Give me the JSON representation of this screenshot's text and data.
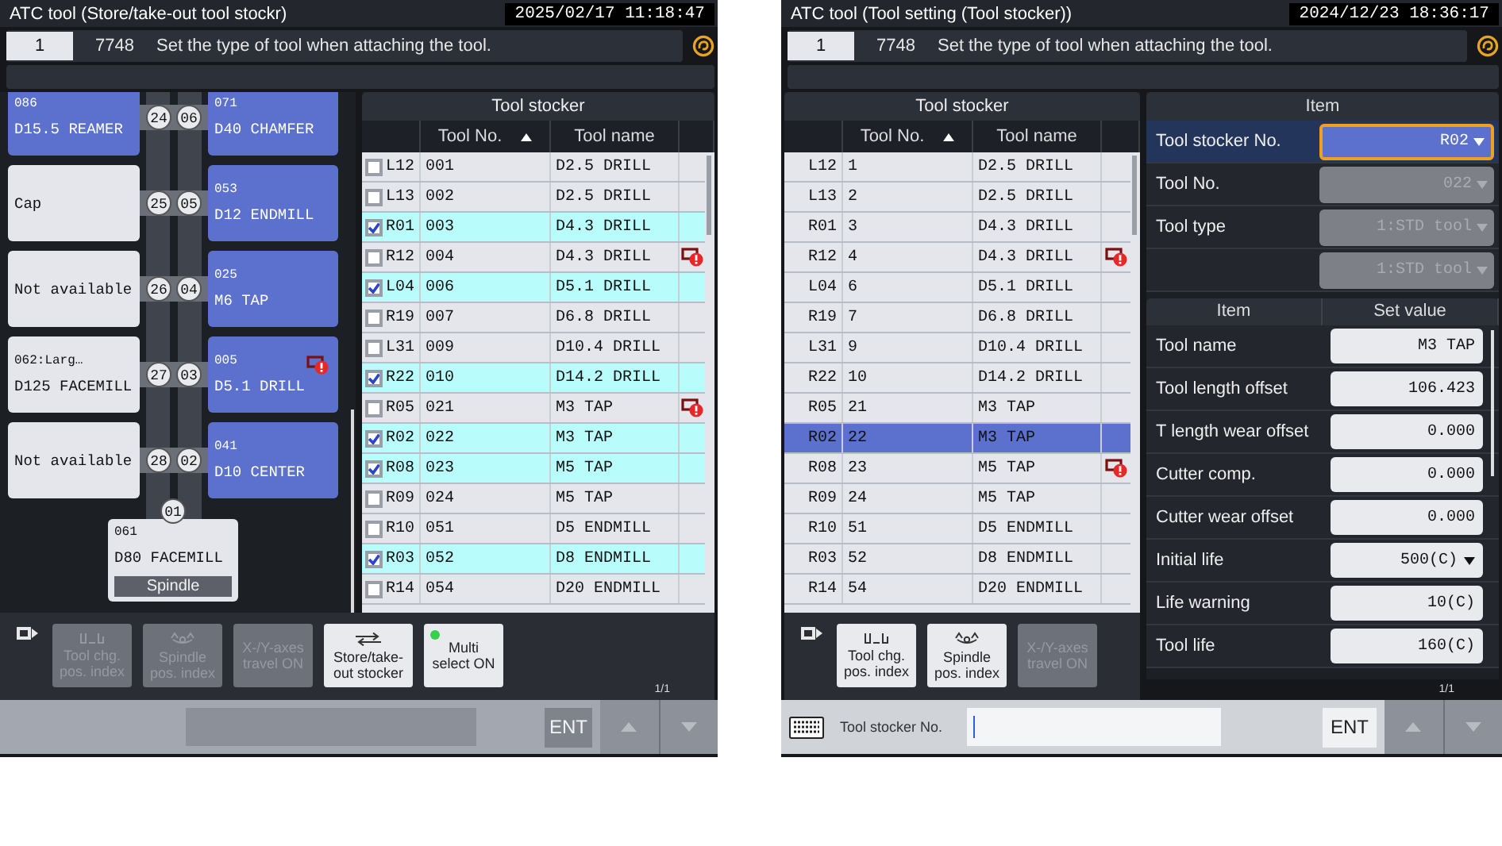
{
  "screens": [
    {
      "title": "ATC tool (Store/take-out tool stockr)",
      "datetime": "2025/02/17 11:18:47",
      "message": {
        "number": "1",
        "code": "7748",
        "text": "Set the type of tool when attaching the tool."
      },
      "magazine": {
        "pockets": [
          {
            "left": {
              "kind": "stored",
              "lines": [
                "086",
                "D15.5 REAMER"
              ],
              "pocket": "24",
              "alert": false
            },
            "right": {
              "kind": "stored",
              "lines": [
                "071",
                "D40 CHAMFER"
              ],
              "pocket": "06",
              "alert": false
            }
          },
          {
            "left": {
              "kind": "blocked",
              "lines": [
                "Cap"
              ],
              "pocket": "25",
              "alert": false
            },
            "right": {
              "kind": "stored",
              "lines": [
                "053",
                "D12 ENDMILL"
              ],
              "pocket": "05",
              "alert": false
            }
          },
          {
            "left": {
              "kind": "blocked",
              "lines": [
                "Not available"
              ],
              "pocket": "26",
              "alert": false
            },
            "right": {
              "kind": "stored",
              "lines": [
                "025",
                "M6 TAP"
              ],
              "pocket": "04",
              "alert": false
            }
          },
          {
            "left": {
              "kind": "blocked",
              "lines": [
                "062:Larg…",
                "D125 FACEMILL"
              ],
              "pocket": "27",
              "alert": false
            },
            "right": {
              "kind": "stored",
              "lines": [
                "005",
                "D5.1 DRILL"
              ],
              "pocket": "03",
              "alert": true
            }
          },
          {
            "left": {
              "kind": "blocked",
              "lines": [
                "Not available"
              ],
              "pocket": "28",
              "alert": false
            },
            "right": {
              "kind": "stored",
              "lines": [
                "041",
                "D10 CENTER"
              ],
              "pocket": "02",
              "alert": false
            }
          }
        ],
        "spindle": {
          "pocket": "01",
          "lines": [
            "061",
            "D80 FACEMILL"
          ],
          "label": "Spindle"
        }
      },
      "stocker": {
        "title": "Tool stocker",
        "columns": [
          "Tool No.",
          "Tool name"
        ],
        "rows": [
          {
            "kind": "checkbox",
            "pocket": "L12",
            "tool_no": "001",
            "name": "D2.5 DRILL",
            "checked": false,
            "alert": false
          },
          {
            "kind": "checkbox",
            "pocket": "L13",
            "tool_no": "002",
            "name": "D2.5 DRILL",
            "checked": false,
            "alert": false
          },
          {
            "kind": "checkbox",
            "pocket": "R01",
            "tool_no": "003",
            "name": "D4.3 DRILL",
            "checked": true,
            "alert": false
          },
          {
            "kind": "checkbox",
            "pocket": "R12",
            "tool_no": "004",
            "name": "D4.3 DRILL",
            "checked": false,
            "alert": true
          },
          {
            "kind": "checkbox",
            "pocket": "L04",
            "tool_no": "006",
            "name": "D5.1 DRILL",
            "checked": true,
            "alert": false
          },
          {
            "kind": "checkbox",
            "pocket": "R19",
            "tool_no": "007",
            "name": "D6.8 DRILL",
            "checked": false,
            "alert": false
          },
          {
            "kind": "checkbox",
            "pocket": "L31",
            "tool_no": "009",
            "name": "D10.4 DRILL",
            "checked": false,
            "alert": false
          },
          {
            "kind": "checkbox",
            "pocket": "R22",
            "tool_no": "010",
            "name": "D14.2 DRILL",
            "checked": true,
            "alert": false
          },
          {
            "kind": "checkbox",
            "pocket": "R05",
            "tool_no": "021",
            "name": "M3 TAP",
            "checked": false,
            "alert": true
          },
          {
            "kind": "checkbox",
            "pocket": "R02",
            "tool_no": "022",
            "name": "M3 TAP",
            "checked": true,
            "alert": false
          },
          {
            "kind": "checkbox",
            "pocket": "R08",
            "tool_no": "023",
            "name": "M5 TAP",
            "checked": true,
            "alert": false
          },
          {
            "kind": "checkbox",
            "pocket": "R09",
            "tool_no": "024",
            "name": "M5 TAP",
            "checked": false,
            "alert": false
          },
          {
            "kind": "checkbox",
            "pocket": "R10",
            "tool_no": "051",
            "name": "D5 ENDMILL",
            "checked": false,
            "alert": false
          },
          {
            "kind": "checkbox",
            "pocket": "R03",
            "tool_no": "052",
            "name": "D8 ENDMILL",
            "checked": true,
            "alert": false
          },
          {
            "kind": "checkbox",
            "pocket": "R14",
            "tool_no": "054",
            "name": "D20 ENDMILL",
            "checked": false,
            "alert": false
          }
        ]
      },
      "function_buttons": [
        {
          "kind": "tool-change",
          "label": "Tool chg. pos. index",
          "disabled": true
        },
        {
          "kind": "spindle",
          "label": "Spindle pos. index",
          "disabled": true
        },
        {
          "kind": "text",
          "label": "X-/Y-axes travel ON",
          "disabled": true
        },
        {
          "kind": "stocker",
          "label": "Store/take-out stocker",
          "disabled": false
        },
        {
          "kind": "indicator",
          "label": "Multi select ON",
          "disabled": false,
          "on": true
        }
      ],
      "input_bar": {
        "disabled": true,
        "enter": "ENT",
        "page": "1/1"
      }
    },
    {
      "title": "ATC tool (Tool setting (Tool stocker))",
      "datetime": "2024/12/23 18:36:17",
      "message": {
        "number": "1",
        "code": "7748",
        "text": "Set the type of tool when attaching the tool."
      },
      "stocker": {
        "title": "Tool stocker",
        "columns": [
          "Tool No.",
          "Tool name"
        ],
        "rows": [
          {
            "kind": "plain",
            "pocket": "L12",
            "tool_no": "1",
            "name": "D2.5 DRILL",
            "selected": false,
            "alert": false
          },
          {
            "kind": "plain",
            "pocket": "L13",
            "tool_no": "2",
            "name": "D2.5 DRILL",
            "selected": false,
            "alert": false
          },
          {
            "kind": "plain",
            "pocket": "R01",
            "tool_no": "3",
            "name": "D4.3 DRILL",
            "selected": false,
            "alert": false
          },
          {
            "kind": "plain",
            "pocket": "R12",
            "tool_no": "4",
            "name": "D4.3 DRILL",
            "selected": false,
            "alert": true
          },
          {
            "kind": "plain",
            "pocket": "L04",
            "tool_no": "6",
            "name": "D5.1 DRILL",
            "selected": false,
            "alert": false
          },
          {
            "kind": "plain",
            "pocket": "R19",
            "tool_no": "7",
            "name": "D6.8 DRILL",
            "selected": false,
            "alert": false
          },
          {
            "kind": "plain",
            "pocket": "L31",
            "tool_no": "9",
            "name": "D10.4 DRILL",
            "selected": false,
            "alert": false
          },
          {
            "kind": "plain",
            "pocket": "R22",
            "tool_no": "10",
            "name": "D14.2 DRILL",
            "selected": false,
            "alert": false
          },
          {
            "kind": "plain",
            "pocket": "R05",
            "tool_no": "21",
            "name": "M3 TAP",
            "selected": false,
            "alert": false
          },
          {
            "kind": "plain",
            "pocket": "R02",
            "tool_no": "22",
            "name": "M3 TAP",
            "selected": true,
            "alert": false
          },
          {
            "kind": "plain",
            "pocket": "R08",
            "tool_no": "23",
            "name": "M5 TAP",
            "selected": false,
            "alert": true
          },
          {
            "kind": "plain",
            "pocket": "R09",
            "tool_no": "24",
            "name": "M5 TAP",
            "selected": false,
            "alert": false
          },
          {
            "kind": "plain",
            "pocket": "R10",
            "tool_no": "51",
            "name": "D5 ENDMILL",
            "selected": false,
            "alert": false
          },
          {
            "kind": "plain",
            "pocket": "R03",
            "tool_no": "52",
            "name": "D8 ENDMILL",
            "selected": false,
            "alert": false
          },
          {
            "kind": "plain",
            "pocket": "R14",
            "tool_no": "54",
            "name": "D20 ENDMILL",
            "selected": false,
            "alert": false
          }
        ]
      },
      "item_panel": {
        "header": "Item",
        "fields": [
          {
            "label": "Tool stocker No.",
            "value": "R02",
            "disabled": false,
            "focused": true
          },
          {
            "label": "Tool No.",
            "value": "022",
            "disabled": true,
            "focused": false
          },
          {
            "label": "Tool type",
            "value": "1:STD tool",
            "disabled": true,
            "focused": false
          },
          {
            "value": "1:STD tool",
            "disabled": true,
            "focused": false
          }
        ],
        "settings": {
          "columns": [
            "Item",
            "Set value"
          ],
          "rows": [
            {
              "kind": "input",
              "label": "Tool name",
              "value": "M3 TAP"
            },
            {
              "kind": "input",
              "label": "Tool length offset",
              "value": "106.423"
            },
            {
              "kind": "input",
              "label": "T length wear offset",
              "value": "0.000"
            },
            {
              "kind": "input",
              "label": "Cutter comp.",
              "value": "0.000"
            },
            {
              "kind": "input",
              "label": "Cutter wear offset",
              "value": "0.000"
            },
            {
              "kind": "dropdown",
              "label": "Initial life",
              "value": "500(C)"
            },
            {
              "kind": "input",
              "label": "Life warning",
              "value": "10(C)"
            },
            {
              "kind": "input",
              "label": "Tool life",
              "value": "160(C)"
            }
          ]
        }
      },
      "function_buttons": [
        {
          "kind": "tool-change",
          "label": "Tool chg. pos. index",
          "disabled": false
        },
        {
          "kind": "spindle",
          "label": "Spindle pos. index",
          "disabled": false
        },
        {
          "kind": "text",
          "label": "X-/Y-axes travel ON",
          "disabled": true
        }
      ],
      "input_bar": {
        "label": "Tool stocker No.",
        "disabled": false,
        "enter": "ENT",
        "page": "1/1"
      }
    }
  ]
}
